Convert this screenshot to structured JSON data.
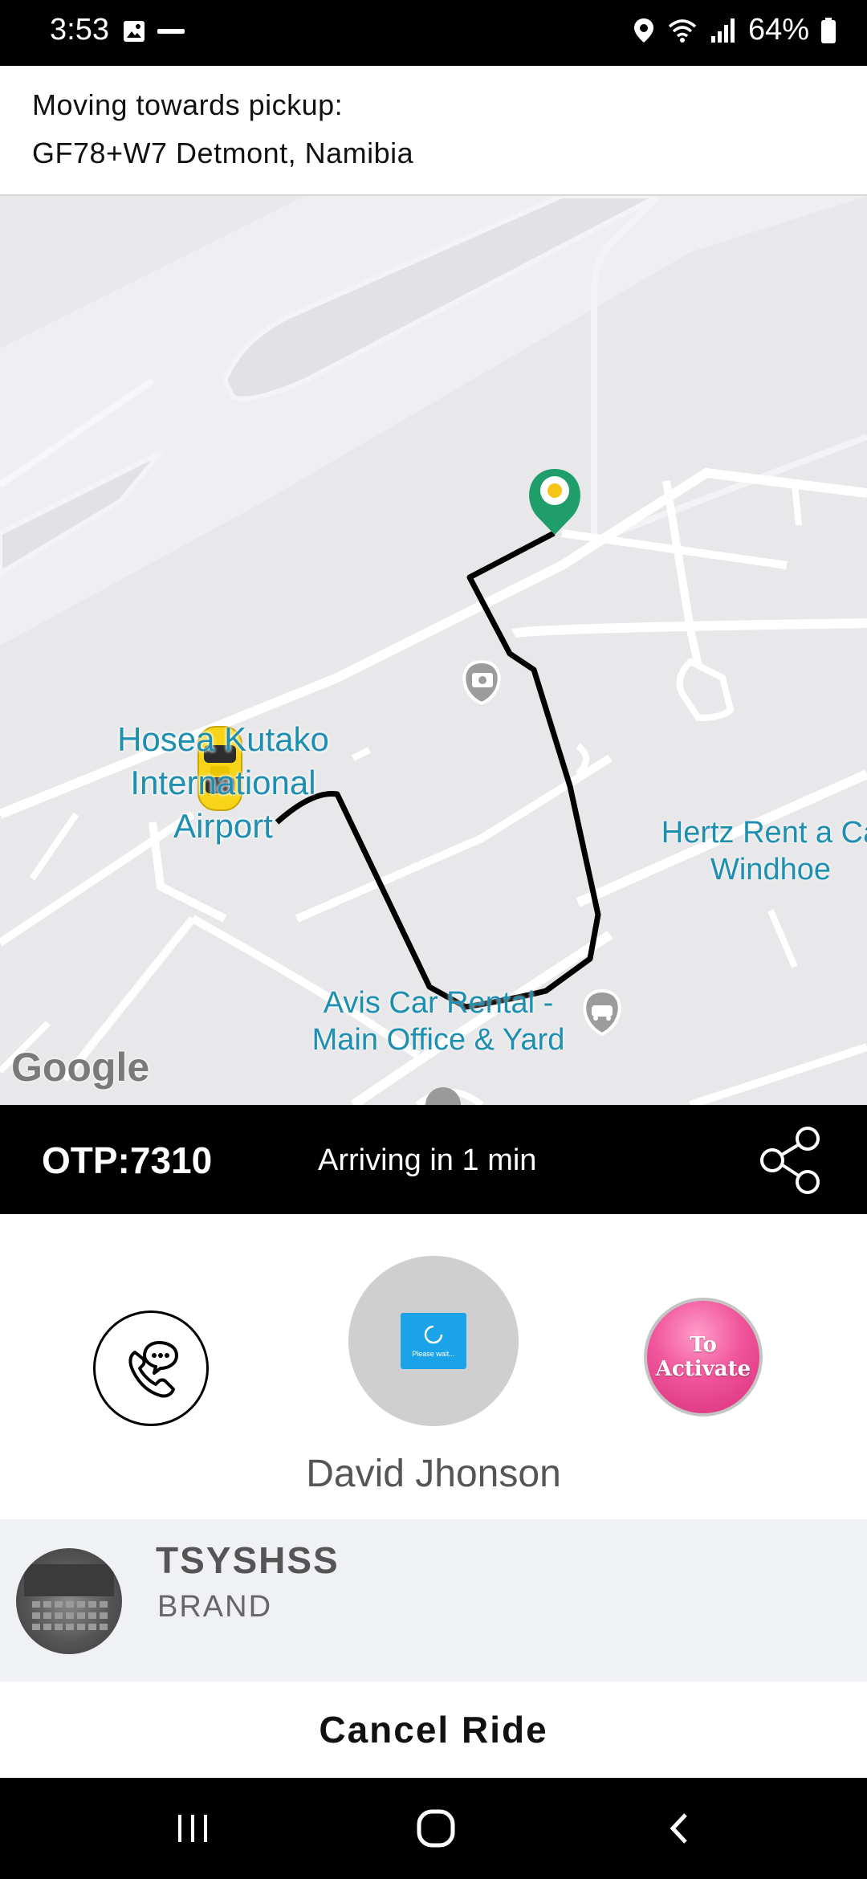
{
  "status_bar": {
    "time": "3:53",
    "battery_percent": "64%",
    "icons": [
      "gallery-icon",
      "app-notification-icon",
      "location-icon",
      "wifi-icon",
      "signal-icon",
      "battery-icon"
    ]
  },
  "header": {
    "label": "Moving towards pickup:",
    "address": "GF78+W7 Detmont, Namibia"
  },
  "map": {
    "airport_label_line1": "Hosea Kutako",
    "airport_label_line2": "International",
    "airport_label_line3": "Airport",
    "hertz_label_line1": "Hertz Rent a Ca",
    "hertz_label_line2": "Windhoe",
    "avis_label_line1": "Avis Car Rental -",
    "avis_label_line2": "Main Office & Yard",
    "attribution": "Google",
    "colors": {
      "route": "#111111",
      "pin": "#1f9d6b",
      "pin_dot": "#f5c518",
      "car": "#f7d417",
      "road": "#ffffff",
      "poi_text": "#1e8fb0"
    }
  },
  "trip": {
    "otp": "OTP:7310",
    "eta": "Arriving in 1 min"
  },
  "driver": {
    "name": "David Jhonson",
    "loading_text": "Please wait...",
    "activate_line1": "To",
    "activate_line2": "Activate"
  },
  "vehicle": {
    "model": "TSYSHSS",
    "brand": "BRAND"
  },
  "actions": {
    "cancel_label": "Cancel Ride"
  },
  "nav": {
    "icons": [
      "recent-apps-icon",
      "home-icon",
      "back-icon"
    ]
  }
}
